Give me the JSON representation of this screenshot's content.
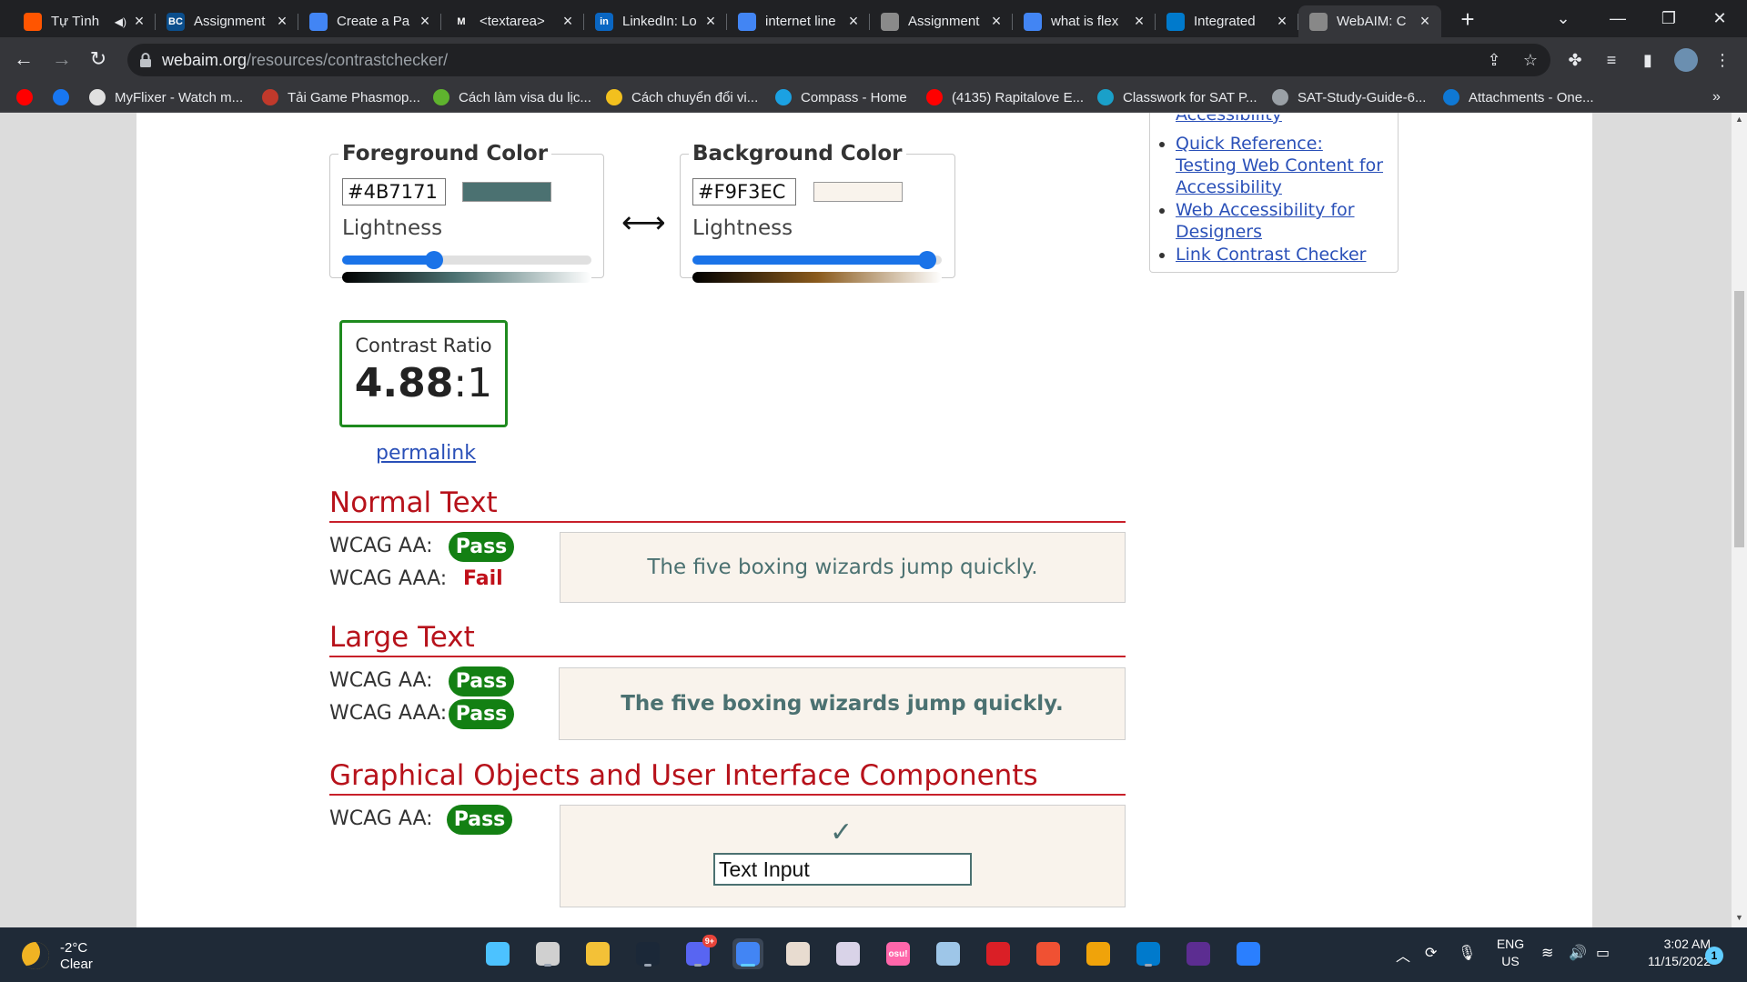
{
  "browser": {
    "tabs": [
      {
        "title": "Tự Tình",
        "has_audio": true,
        "favicon_color": "#ff5500",
        "favicon_glyph": "soundcloud-icon"
      },
      {
        "title": "Assignment",
        "favicon_color": "#0b4e8c",
        "favicon_glyph": "bcit-icon",
        "favicon_text": "BCIT"
      },
      {
        "title": "Create a Pa",
        "favicon_color": "#4285f4",
        "favicon_glyph": "google-icon"
      },
      {
        "title": "<textarea>",
        "favicon_color": "#202124",
        "favicon_glyph": "mdn-icon",
        "favicon_text": "M"
      },
      {
        "title": "LinkedIn: Lo",
        "favicon_color": "#0a66c2",
        "favicon_glyph": "linkedin-icon",
        "favicon_text": "in"
      },
      {
        "title": "internet line",
        "favicon_color": "#4285f4",
        "favicon_glyph": "google-icon"
      },
      {
        "title": "Assignment",
        "favicon_color": "#8a8a8a",
        "favicon_glyph": "globe-icon"
      },
      {
        "title": "what is flex",
        "favicon_color": "#4285f4",
        "favicon_glyph": "google-icon"
      },
      {
        "title": "Integrated",
        "favicon_color": "#007acc",
        "favicon_glyph": "vscode-icon"
      },
      {
        "title": "WebAIM: C",
        "favicon_color": "#888888",
        "favicon_glyph": "gear-icon",
        "active": true
      }
    ],
    "url_host": "webaim.org",
    "url_path": "/resources/contrastchecker/",
    "bookmarks": [
      {
        "label": "",
        "color": "#ff0000",
        "icon": "youtube-icon"
      },
      {
        "label": "",
        "color": "#1877f2",
        "icon": "facebook-icon"
      },
      {
        "label": "MyFlixer - Watch m...",
        "color": "#e0e0e0",
        "icon": "myflixer-icon"
      },
      {
        "label": "Tải Game Phasmop...",
        "color": "#c0392b",
        "icon": "game-icon"
      },
      {
        "label": "Cách làm visa du lịc...",
        "color": "#5fb32e",
        "icon": "visa-icon"
      },
      {
        "label": "Cách chuyển đổi vi...",
        "color": "#f2c01e",
        "icon": "convert-icon"
      },
      {
        "label": "Compass - Home",
        "color": "#1ba1e2",
        "icon": "compass-icon"
      },
      {
        "label": "(4135) Rapitalove E...",
        "color": "#ff0000",
        "icon": "youtube-icon"
      },
      {
        "label": "Classwork for SAT P...",
        "color": "#1aa0c9",
        "icon": "classroom-icon"
      },
      {
        "label": "SAT-Study-Guide-6...",
        "color": "#9aa0a6",
        "icon": "globe-icon"
      },
      {
        "label": "Attachments - One...",
        "color": "#0f78d4",
        "icon": "onedrive-icon"
      }
    ]
  },
  "checker": {
    "foreground": {
      "legend": "Foreground Color",
      "hex": "#4B7171",
      "swatch": "#4b7171",
      "lightness_label": "Lightness",
      "lightness_level": 0.37
    },
    "background": {
      "legend": "Background Color",
      "hex": "#F9F3EC",
      "swatch": "#f9f3ec",
      "lightness_label": "Lightness",
      "lightness_level": 0.94
    },
    "swap_symbol": "⟷",
    "ratio_label": "Contrast Ratio",
    "ratio_value": "4.88",
    "ratio_suffix": ":1",
    "permalink": "permalink"
  },
  "results": {
    "normal": {
      "heading": "Normal Text",
      "aa_label": "WCAG AA:",
      "aa_result": "Pass",
      "aaa_label": "WCAG AAA:",
      "aaa_result": "Fail",
      "sample": "The five boxing wizards jump quickly."
    },
    "large": {
      "heading": "Large Text",
      "aa_label": "WCAG AA:",
      "aa_result": "Pass",
      "aaa_label": "WCAG AAA:",
      "aaa_result": "Pass",
      "sample": "The five boxing wizards jump quickly."
    },
    "graphical": {
      "heading": "Graphical Objects and User Interface Components",
      "aa_label": "WCAG AA:",
      "aa_result": "Pass",
      "check": "✓",
      "input_value": "Text Input"
    }
  },
  "sidebar": {
    "cutoff_item": "Accessibility",
    "links": [
      "Quick Reference: Testing Web Content for Accessibility",
      "Web Accessibility for Designers",
      "Link Contrast Checker"
    ]
  },
  "taskbar": {
    "temperature": "-2°C",
    "condition": "Clear",
    "apps": [
      {
        "name": "start-icon",
        "color": "#4cc2ff"
      },
      {
        "name": "task-view-icon",
        "color": "#d0d0d0"
      },
      {
        "name": "file-explorer-icon",
        "color": "#f3c137"
      },
      {
        "name": "steam-icon",
        "color": "#1b2838"
      },
      {
        "name": "discord-icon",
        "color": "#5865f2",
        "badge": "9+"
      },
      {
        "name": "chrome-icon",
        "color": "#4285f4",
        "active": true
      },
      {
        "name": "anime-app-icon",
        "color": "#e8dcd0"
      },
      {
        "name": "anime-app-2-icon",
        "color": "#d9d3e8"
      },
      {
        "name": "osu-icon",
        "color": "#ff66aa",
        "text": "osu!"
      },
      {
        "name": "photos-icon",
        "color": "#9ec6e8"
      },
      {
        "name": "creative-cloud-icon",
        "color": "#da1f26"
      },
      {
        "name": "git-icon",
        "color": "#f05133"
      },
      {
        "name": "draw-icon",
        "color": "#f0a30a"
      },
      {
        "name": "vscode-icon",
        "color": "#007acc"
      },
      {
        "name": "visual-studio-icon",
        "color": "#5c2d91"
      },
      {
        "name": "remote-icon",
        "color": "#2a7fff"
      }
    ],
    "language": "ENG",
    "region": "US",
    "time": "3:02 AM",
    "date": "11/15/2022",
    "notification_count": "1"
  }
}
